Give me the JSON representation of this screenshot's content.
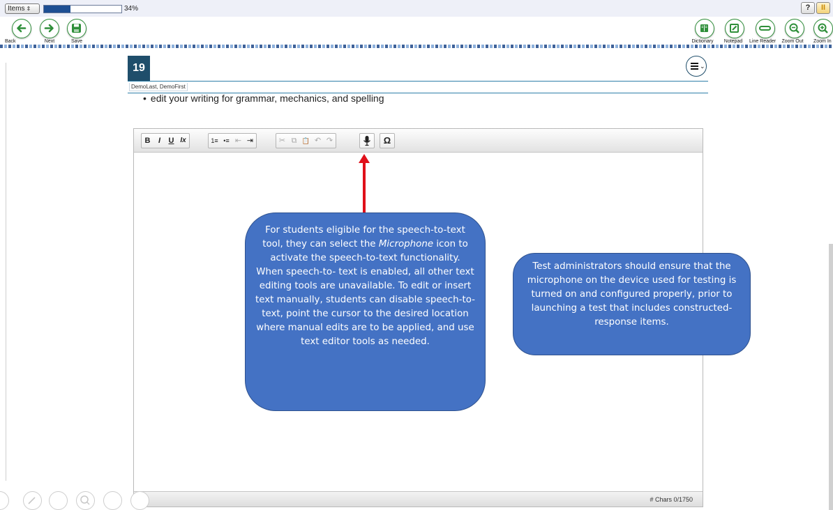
{
  "topbar": {
    "items_label": "Items",
    "progress_percent": 34,
    "progress_text": "34%",
    "help_label": "?",
    "pause_label": "II"
  },
  "nav": {
    "back_label": "Back",
    "next_label": "Next",
    "save_label": "Save"
  },
  "tools": {
    "dictionary_label": "Dictionary",
    "notepad_label": "Notepad",
    "line_reader_label": "Line Reader",
    "zoom_out_label": "Zoom Out",
    "zoom_in_label": "Zoom In"
  },
  "question": {
    "number": "19",
    "student_name": "DemoLast, DemoFirst",
    "instruction": "edit your writing for grammar, mechanics, and spelling"
  },
  "editor": {
    "toolbar": {
      "bold": "B",
      "italic": "I",
      "underline": "U",
      "clear_format": "Ix",
      "ordered_list": "1≡",
      "bullet_list": "•≡",
      "outdent": "⇤",
      "indent": "⇥",
      "cut": "✂",
      "copy": "⧉",
      "paste": "📋",
      "undo": "↶",
      "redo": "↷",
      "microphone": "🎤",
      "special_char": "Ω"
    },
    "char_count": "# Chars 0/1750"
  },
  "callouts": {
    "left_part1": "For students eligible for the speech-to-text tool, they can select the",
    "left_italic": "Microphone",
    "left_part2": "icon to activate the speech-to-text functionality. When speech-to- text is enabled, all other text editing tools are unavailable. To edit or insert text manually, students can disable speech-to- text, point the cursor to the desired location where manual edits are to be applied, and use text editor tools as needed.",
    "right_text": "Test administrators should ensure that the microphone on the device used for testing is turned on and configured properly, prior to launching a test that includes constructed-response items."
  },
  "colors": {
    "nav_green": "#2f8f3a",
    "header_blue": "#1f4e6b",
    "progress_blue": "#1e4f93",
    "callout_blue": "#4472c4",
    "arrow_red": "#e0101a"
  }
}
